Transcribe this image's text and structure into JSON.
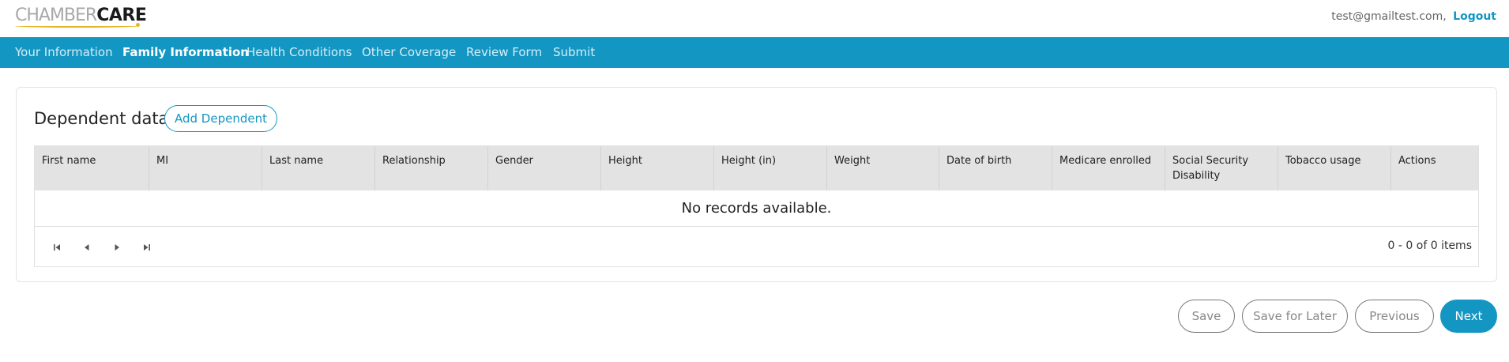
{
  "brand": {
    "part1": "CHAMBER",
    "part2": "CARE"
  },
  "user": {
    "email": "test@gmailtest.com,",
    "logout_label": "Logout"
  },
  "nav": {
    "items": [
      {
        "label": "Your Information"
      },
      {
        "label": "Family Information"
      },
      {
        "label": "Health Conditions"
      },
      {
        "label": "Other Coverage"
      },
      {
        "label": "Review Form"
      },
      {
        "label": "Submit"
      }
    ],
    "active": "Family Information"
  },
  "dependents": {
    "title": "Dependent data",
    "add_label": "Add Dependent",
    "columns": [
      "First name",
      "MI",
      "Last name",
      "Relationship",
      "Gender",
      "Height",
      "Height (in)",
      "Weight",
      "Date of birth",
      "Medicare enrolled",
      "Social Security Disability",
      "Tobacco usage",
      "Actions"
    ],
    "empty_text": "No records available.",
    "pager_info": "0 - 0 of 0 items",
    "pager_icons": [
      "first-page-icon",
      "prev-page-icon",
      "next-page-icon",
      "last-page-icon"
    ]
  },
  "footer_buttons": {
    "save": "Save",
    "save_later": "Save for Later",
    "previous": "Previous",
    "next": "Next"
  },
  "colors": {
    "accent": "#1496c3",
    "logo_accent": "#e9b429",
    "header_bg": "#e3e3e3"
  }
}
